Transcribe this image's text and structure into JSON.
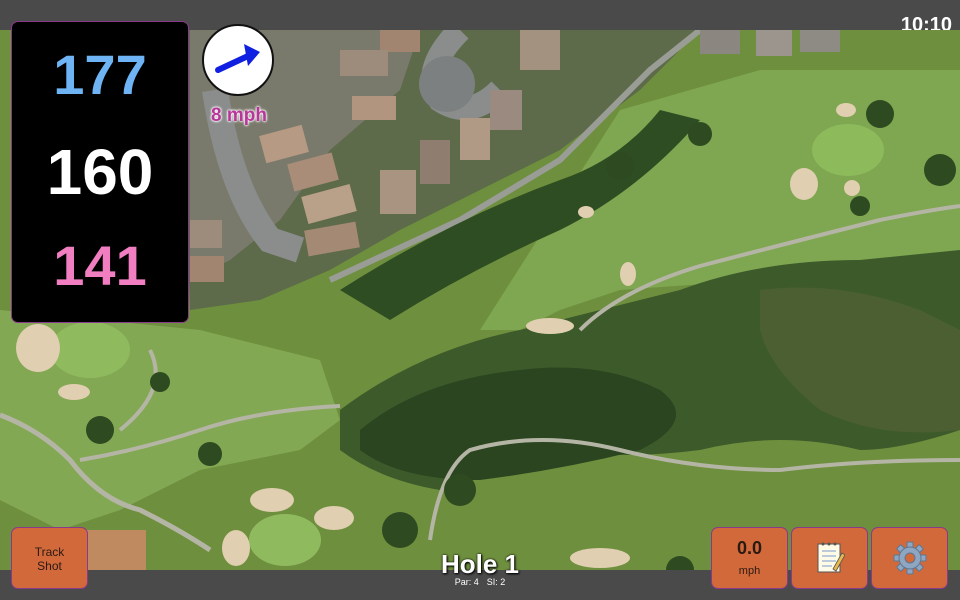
{
  "status_bar": {
    "time": "10:10"
  },
  "distances": {
    "back": {
      "value": "177",
      "color": "#6eb4f4"
    },
    "middle": {
      "value": "160",
      "color": "#ffffff"
    },
    "front": {
      "value": "141",
      "color": "#f07ec0"
    }
  },
  "wind": {
    "speed_label": "8 mph",
    "icon": "wind-arrow-icon",
    "label_color": "#b8369a"
  },
  "hole": {
    "title": "Hole 1",
    "par_label": "Par: 4",
    "si_label": "SI: 2"
  },
  "buttons": {
    "track_shot_line1": "Track",
    "track_shot_line2": "Shot",
    "speed_value": "0.0",
    "speed_unit": "mph",
    "notes_icon": "notepad-icon",
    "settings_icon": "gear-icon"
  },
  "colors": {
    "button": "#d2693a",
    "accent_border": "#8a3a8a",
    "panel": "#000000"
  }
}
